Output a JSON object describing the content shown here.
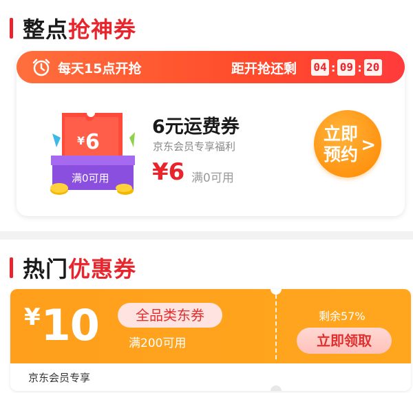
{
  "flash_section": {
    "title_black": "整点",
    "title_red": "抢神券",
    "banner_left": "每天15点开抢",
    "banner_right": "距开抢还剩",
    "timer": {
      "hours": "04",
      "minutes": "09",
      "seconds": "20",
      "sep": ":"
    },
    "ticket_value": "¥6",
    "ticket_cond": "满0可用",
    "coupon_name": "6元运费券",
    "coupon_sub": "京东会员专享福利",
    "coupon_price": "¥6",
    "coupon_cond": "满0可用",
    "reserve_line1": "立即",
    "reserve_line2": "预约",
    "reserve_chevron": ">"
  },
  "hot_section": {
    "title_black": "热门",
    "title_red": "优惠券",
    "price_symbol": "¥",
    "price_value": "10",
    "tag": "全品类东券",
    "cond": "满200可用",
    "remain": "剩余57%",
    "claim_label": "立即领取",
    "bottom_text": "京东会员专享"
  },
  "colors": {
    "accent": "#e8252c",
    "orange": "#ff9f1c"
  }
}
